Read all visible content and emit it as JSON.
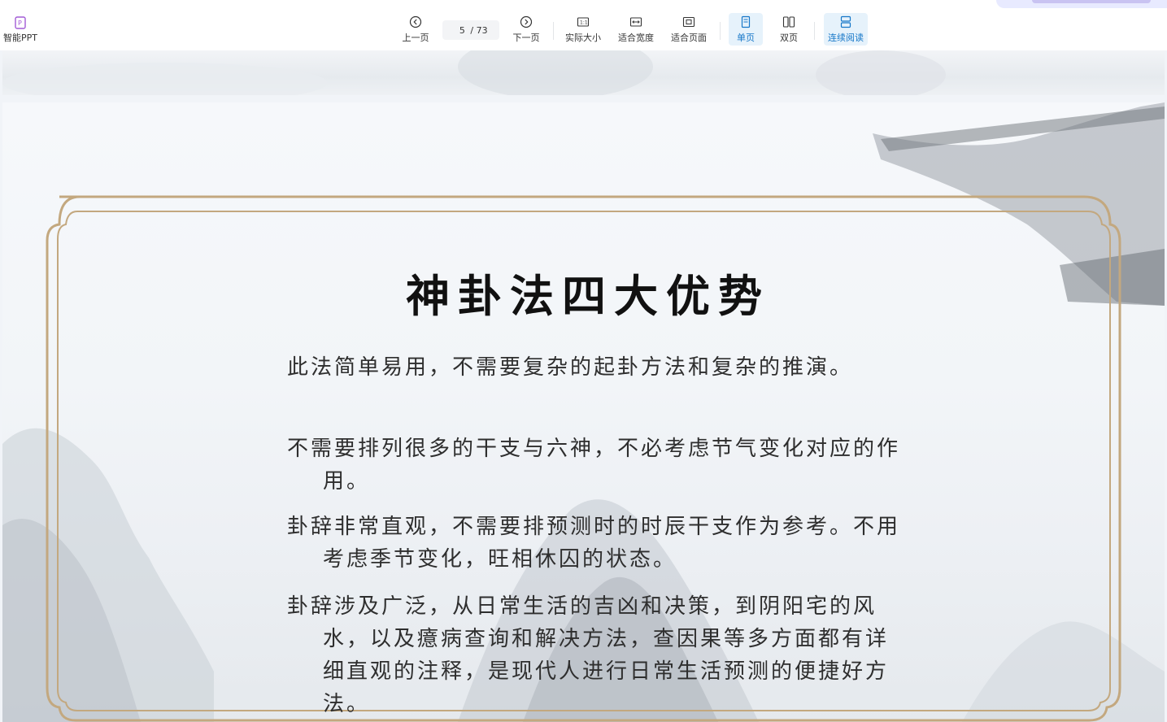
{
  "toolbar": {
    "ppt_label": "智能PPT",
    "prev_label": "上一页",
    "page_current": "5",
    "page_total": "/ 73",
    "next_label": "下一页",
    "actual_size_label": "实际大小",
    "fit_width_label": "适合宽度",
    "fit_page_label": "适合页面",
    "single_page_label": "单页",
    "double_page_label": "双页",
    "continuous_label": "连续阅读",
    "active_color": "#1677c8"
  },
  "slide": {
    "title": "神卦法四大优势",
    "paragraphs": [
      "此法简单易用，不需要复杂的起卦方法和复杂的推演。",
      "不需要排列很多的干支与六神，不必考虑节气变化对应的作用。",
      "卦辞非常直观，不需要排预测时的时辰干支作为参考。不用考虑季节变化，旺相休囚的状态。",
      "卦辞涉及广泛，从日常生活的吉凶和决策，到阴阳宅的风水，以及癔病查询和解决方法，查因果等多方面都有详细直观的注释，是现代人进行日常生活预测的便捷好方法。"
    ],
    "frame_color": "#c3a87f"
  }
}
